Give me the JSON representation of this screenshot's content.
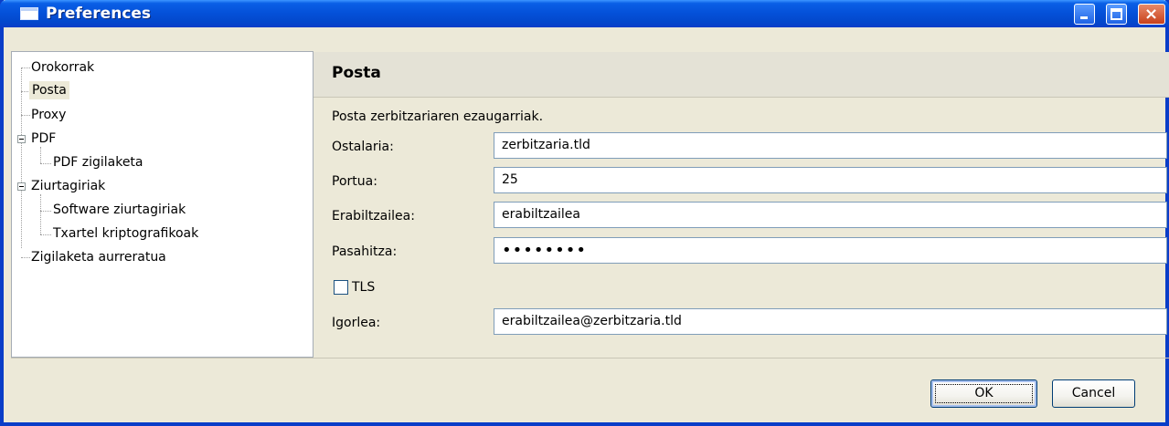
{
  "window": {
    "title": "Preferences",
    "controls": {
      "minimize": "minimize",
      "maximize": "maximize",
      "close": "×"
    }
  },
  "tree": {
    "items": [
      {
        "label": "Orokorrak"
      },
      {
        "label": "Posta"
      },
      {
        "label": "Proxy"
      },
      {
        "label": "PDF"
      },
      {
        "label": "PDF zigilaketa"
      },
      {
        "label": "Ziurtagiriak"
      },
      {
        "label": "Software ziurtagiriak"
      },
      {
        "label": "Txartel kriptografikoak"
      },
      {
        "label": "Zigilaketa aurreratua"
      }
    ]
  },
  "panel": {
    "title": "Posta",
    "description": "Posta zerbitzariaren ezaugarriak.",
    "fields": {
      "host": {
        "label": "Ostalaria:",
        "value": "zerbitzaria.tld"
      },
      "port": {
        "label": "Portua:",
        "value": "25"
      },
      "user": {
        "label": "Erabiltzailea:",
        "value": "erabiltzailea"
      },
      "password": {
        "label": "Pasahitza:",
        "value": "••••••••"
      },
      "tls": {
        "label": "TLS",
        "checked": false
      },
      "sender": {
        "label": "Igorlea:",
        "value": "erabiltzailea@zerbitzaria.tld"
      }
    }
  },
  "buttons": {
    "ok": "OK",
    "cancel": "Cancel"
  }
}
